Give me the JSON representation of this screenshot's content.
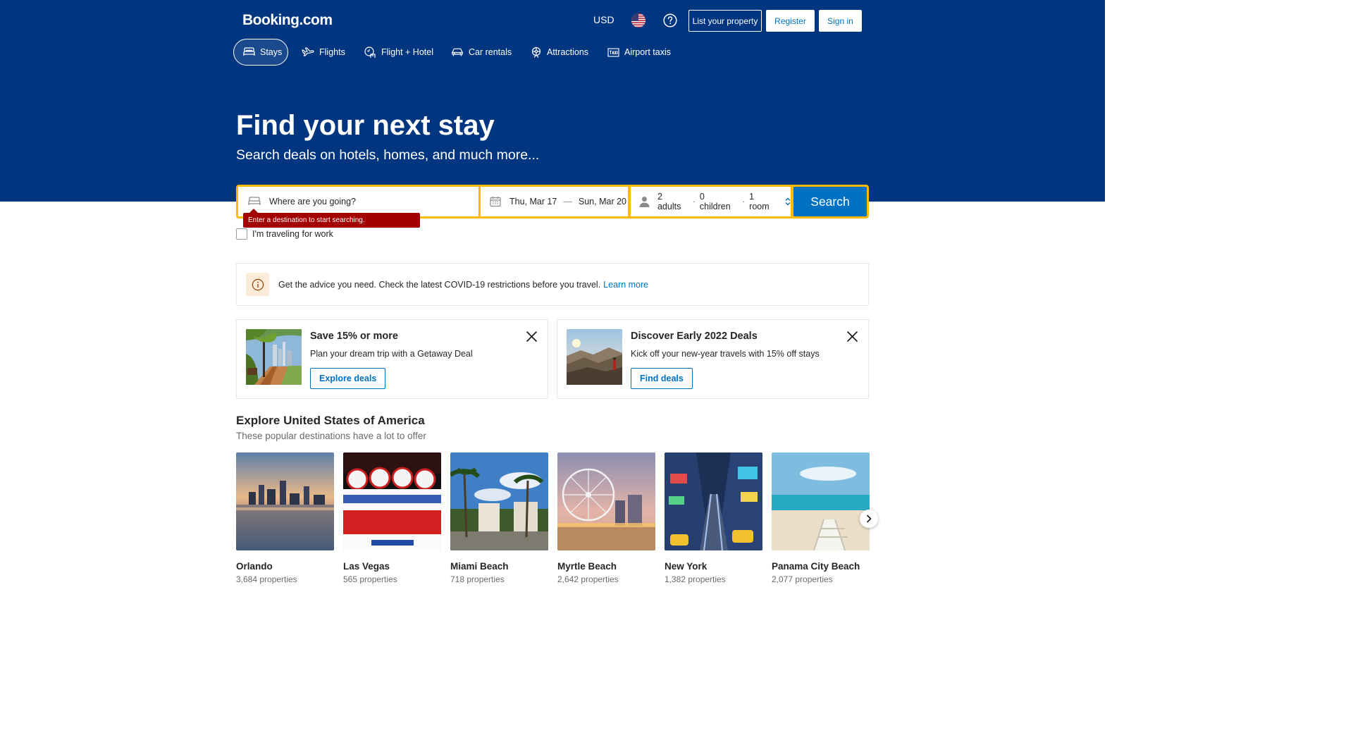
{
  "brand": {
    "logo": "Booking.com",
    "accent": "#003580",
    "button_blue": "#0071c2",
    "search_yellow": "#febb02"
  },
  "header": {
    "currency": "USD",
    "flag_icon": "us-flag-icon",
    "help_icon": "question-circle-icon",
    "list_property": "List your property",
    "register": "Register",
    "sign_in": "Sign in"
  },
  "nav": {
    "stays": "Stays",
    "flights": "Flights",
    "flight_hotel": "Flight + Hotel",
    "car_rentals": "Car rentals",
    "attractions": "Attractions",
    "airport_taxis": "Airport taxis"
  },
  "hero": {
    "title": "Find your next stay",
    "subtitle": "Search deals on hotels, homes, and much more..."
  },
  "search": {
    "destination_placeholder": "Where are you going?",
    "checkin": "Thu, Mar 17",
    "date_separator": "—",
    "checkout": "Sun, Mar 20",
    "adults": "2 adults",
    "children": "0 children",
    "rooms": "1 room",
    "separator": "·",
    "button": "Search",
    "error": "Enter a destination to start searching.",
    "work_label": "I'm traveling for work"
  },
  "covid": {
    "text": "Get the advice you need. Check the latest COVID-19 restrictions before you travel.",
    "link": "Learn more"
  },
  "promos": [
    {
      "title": "Save 15% or more",
      "desc": "Plan your dream trip with a Getaway Deal",
      "button": "Explore deals"
    },
    {
      "title": "Discover Early 2022 Deals",
      "desc": "Kick off your new-year travels with 15% off stays",
      "button": "Find deals"
    }
  ],
  "explore": {
    "title": "Explore United States of America",
    "subtitle": "These popular destinations have a lot to offer",
    "destinations": [
      {
        "name": "Orlando",
        "count": "3,684 properties"
      },
      {
        "name": "Las Vegas",
        "count": "565 properties"
      },
      {
        "name": "Miami Beach",
        "count": "718 properties"
      },
      {
        "name": "Myrtle Beach",
        "count": "2,642 properties"
      },
      {
        "name": "New York",
        "count": "1,382 properties"
      },
      {
        "name": "Panama City Beach",
        "count": "2,077 properties"
      }
    ]
  }
}
